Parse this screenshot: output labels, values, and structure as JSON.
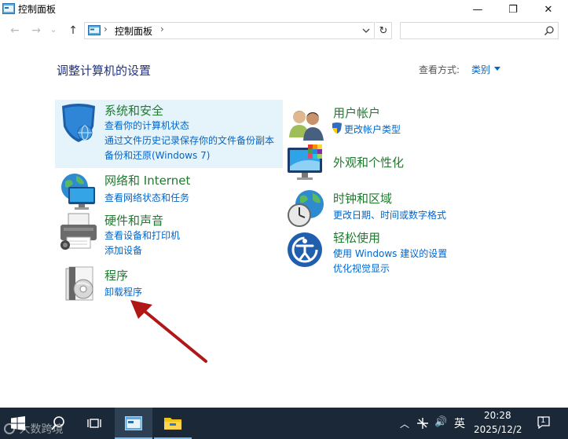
{
  "window": {
    "title": "控制面板",
    "minimize_glyph": "—",
    "maximize_glyph": "❐",
    "close_glyph": "✕"
  },
  "nav": {
    "back_glyph": "←",
    "forward_glyph": "→",
    "recent_glyph": "⌄",
    "up_glyph": "↑",
    "breadcrumb": "控制面板",
    "chevron": "›",
    "refresh_glyph": "↻",
    "search_placeholder": ""
  },
  "main": {
    "heading": "调整计算机的设置",
    "view_by_label": "查看方式:",
    "view_by_value": "类别"
  },
  "categories_left": [
    {
      "title": "系统和安全",
      "icon": "shield-icon",
      "links": [
        "查看你的计算机状态",
        "通过文件历史记录保存你的文件备份副本",
        "备份和还原(Windows 7)"
      ]
    },
    {
      "title": "网络和 Internet",
      "icon": "network-globe-icon",
      "links": [
        "查看网络状态和任务"
      ]
    },
    {
      "title": "硬件和声音",
      "icon": "printer-icon",
      "links": [
        "查看设备和打印机",
        "添加设备"
      ]
    },
    {
      "title": "程序",
      "icon": "programs-disc-icon",
      "links": [
        "卸载程序"
      ]
    }
  ],
  "categories_right": [
    {
      "title": "用户帐户",
      "icon": "users-icon",
      "links": [
        "更改帐户类型"
      ]
    },
    {
      "title": "外观和个性化",
      "icon": "monitor-palette-icon",
      "links": []
    },
    {
      "title": "时钟和区域",
      "icon": "clock-globe-icon",
      "links": [
        "更改日期、时间或数字格式"
      ]
    },
    {
      "title": "轻松使用",
      "icon": "ease-of-access-icon",
      "links": [
        "使用 Windows 建议的设置",
        "优化视觉显示"
      ]
    }
  ],
  "taskbar": {
    "time": "20:28",
    "date": "2025/12/2",
    "ime": "英",
    "volume_glyph": "🔊",
    "chevron_glyph": "︿",
    "notification_count": "1",
    "watermark": "大数跨境"
  },
  "colors": {
    "accent_link": "#0066cc",
    "category_title": "#1e7a2d",
    "heading": "#1e3287",
    "highlight": "#e5f3fb",
    "taskbar": "#1b2838",
    "annotation_arrow": "#b01818"
  }
}
